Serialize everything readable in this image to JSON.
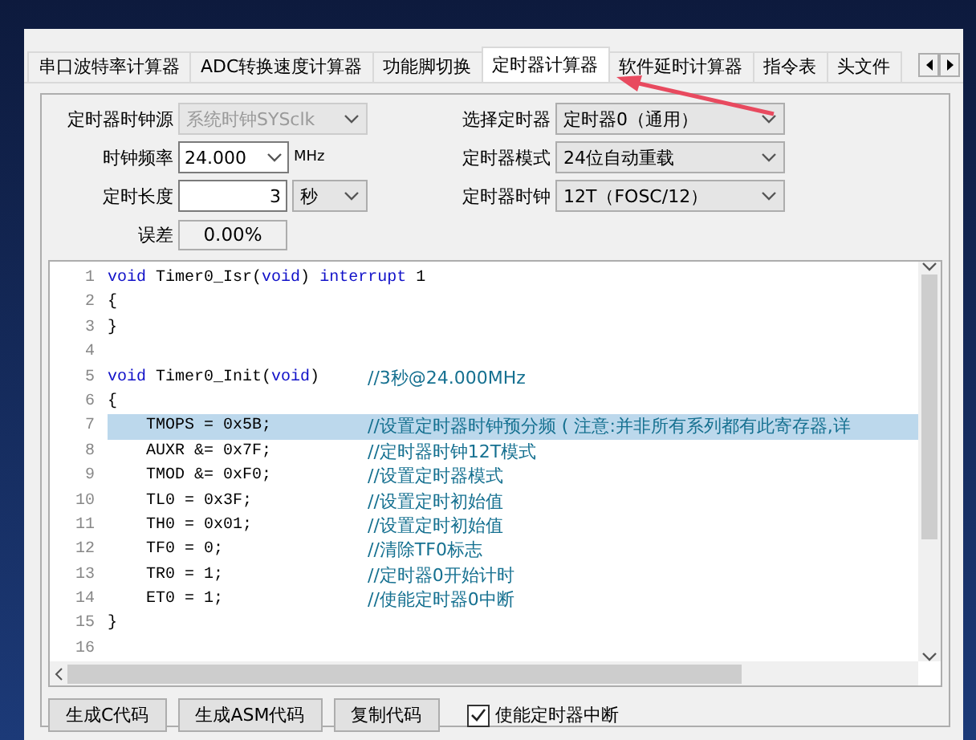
{
  "tabs": [
    {
      "label": "串口波特率计算器",
      "selected": false
    },
    {
      "label": "ADC转换速度计算器",
      "selected": false
    },
    {
      "label": "功能脚切换",
      "selected": false
    },
    {
      "label": "定时器计算器",
      "selected": true
    },
    {
      "label": "软件延时计算器",
      "selected": false
    },
    {
      "label": "指令表",
      "selected": false
    },
    {
      "label": "头文件",
      "selected": false
    }
  ],
  "left_fields": [
    {
      "label": "定时器时钟源",
      "kind": "select",
      "value": "系统时钟SYSclk",
      "disabled": true
    },
    {
      "label": "时钟频率",
      "kind": "combo",
      "value": "24.000",
      "unit": "MHz",
      "disabled": false
    },
    {
      "label": "定时长度",
      "kind": "spin",
      "value": "3",
      "unit": "秒",
      "disabled": false
    },
    {
      "label": "误差",
      "kind": "readout",
      "value": "0.00%",
      "disabled": false
    }
  ],
  "right_fields": [
    {
      "label": "选择定时器",
      "value": "定时器0（通用）",
      "disabled": false
    },
    {
      "label": "定时器模式",
      "value": "24位自动重载",
      "disabled": false
    },
    {
      "label": "定时器时钟",
      "value": "12T（FOSC/12）",
      "disabled": false
    }
  ],
  "code_lines": [
    {
      "number": "1",
      "tokens": [
        {
          "kind": "keyword",
          "text": "void"
        },
        {
          "kind": "plain",
          "text": " Timer0_Isr("
        },
        {
          "kind": "keyword",
          "text": "void"
        },
        {
          "kind": "plain",
          "text": ") "
        },
        {
          "kind": "keyword",
          "text": "interrupt"
        },
        {
          "kind": "plain",
          "text": " 1"
        }
      ],
      "selected": false
    },
    {
      "number": "2",
      "tokens": [
        {
          "kind": "plain",
          "text": "{"
        }
      ],
      "selected": false
    },
    {
      "number": "3",
      "tokens": [
        {
          "kind": "plain",
          "text": "}"
        }
      ],
      "selected": false
    },
    {
      "number": "4",
      "selected": false
    },
    {
      "number": "5",
      "tokens": [
        {
          "kind": "keyword",
          "text": "void"
        },
        {
          "kind": "plain",
          "text": " Timer0_Init("
        },
        {
          "kind": "keyword",
          "text": "void"
        },
        {
          "kind": "plain",
          "text": ")"
        }
      ],
      "comment": "//3秒@24.000MHz",
      "selected": false
    },
    {
      "number": "6",
      "tokens": [
        {
          "kind": "plain",
          "text": "{"
        }
      ],
      "selected": false
    },
    {
      "number": "7",
      "tokens": [
        {
          "kind": "plain",
          "text": "    TMOPS = 0x5B;"
        }
      ],
      "comment": "//设置定时器时钟预分频 ( 注意:并非所有系列都有此寄存器,详",
      "selected": true
    },
    {
      "number": "8",
      "tokens": [
        {
          "kind": "plain",
          "text": "    AUXR &= 0x7F;"
        }
      ],
      "comment": "//定时器时钟12T模式",
      "selected": false
    },
    {
      "number": "9",
      "tokens": [
        {
          "kind": "plain",
          "text": "    TMOD &= 0xF0;"
        }
      ],
      "comment": "//设置定时器模式",
      "selected": false
    },
    {
      "number": "10",
      "tokens": [
        {
          "kind": "plain",
          "text": "    TL0 = 0x3F;"
        }
      ],
      "comment": "//设置定时初始值",
      "selected": false
    },
    {
      "number": "11",
      "tokens": [
        {
          "kind": "plain",
          "text": "    TH0 = 0x01;"
        }
      ],
      "comment": "//设置定时初始值",
      "selected": false
    },
    {
      "number": "12",
      "tokens": [
        {
          "kind": "plain",
          "text": "    TF0 = 0;"
        }
      ],
      "comment": "//清除TF0标志",
      "selected": false
    },
    {
      "number": "13",
      "tokens": [
        {
          "kind": "plain",
          "text": "    TR0 = 1;"
        }
      ],
      "comment": "//定时器0开始计时",
      "selected": false
    },
    {
      "number": "14",
      "tokens": [
        {
          "kind": "plain",
          "text": "    ET0 = 1;"
        }
      ],
      "comment": "//使能定时器0中断",
      "selected": false
    },
    {
      "number": "15",
      "tokens": [
        {
          "kind": "plain",
          "text": "}"
        }
      ],
      "selected": false
    },
    {
      "number": "16",
      "selected": false
    }
  ],
  "buttons": [
    "生成C代码",
    "生成ASM代码",
    "复制代码"
  ],
  "interrupt_checkbox": {
    "label": "使能定时器中断",
    "checked": true
  }
}
